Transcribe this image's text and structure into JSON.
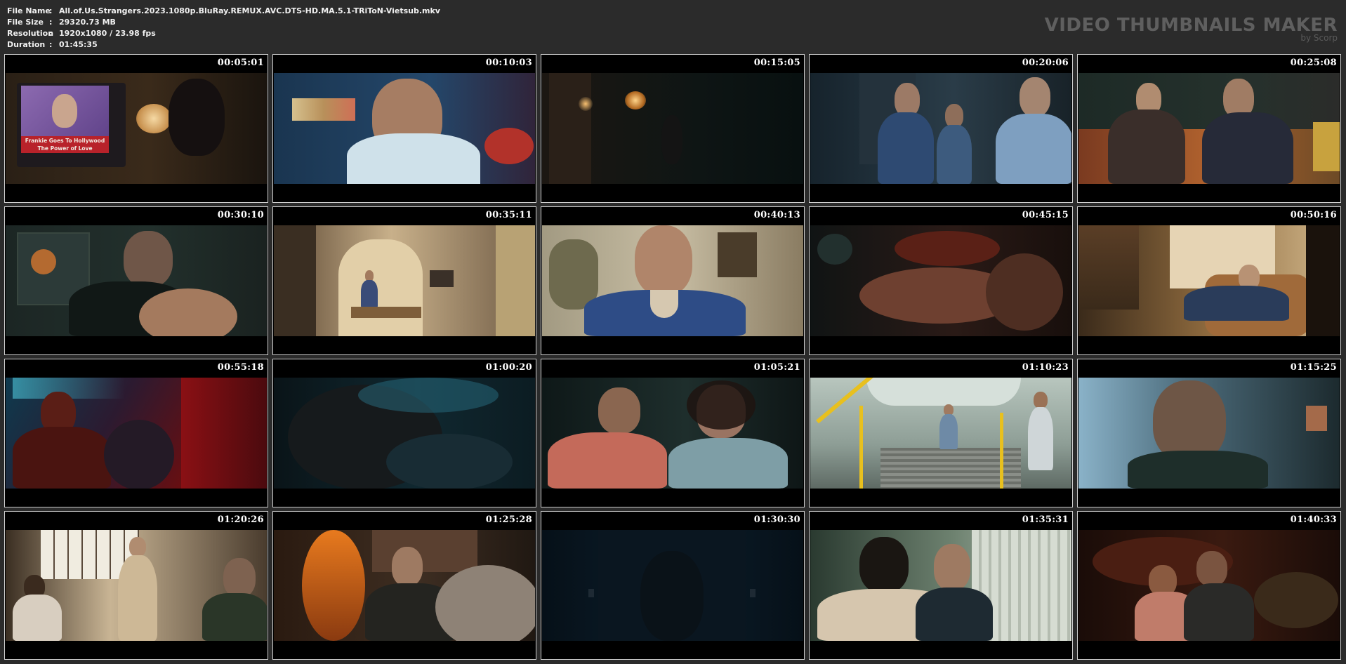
{
  "info": {
    "file_name_label": "File Name",
    "file_name": "All.of.Us.Strangers.2023.1080p.BluRay.REMUX.AVC.DTS-HD.MA.5.1-TRiToN-Vietsub.mkv",
    "file_size_label": "File Size",
    "file_size": "29320.73 MB",
    "resolution_label": "Resolution",
    "resolution": "1920x1080 / 23.98 fps",
    "duration_label": "Duration",
    "duration": "01:45:35",
    "separator": ":"
  },
  "brand": {
    "title": "VIDEO THUMBNAILS MAKER",
    "subtitle": "by Scorp"
  },
  "thumbnails": [
    {
      "time": "00:05:01"
    },
    {
      "time": "00:10:03"
    },
    {
      "time": "00:15:05"
    },
    {
      "time": "00:20:06"
    },
    {
      "time": "00:25:08"
    },
    {
      "time": "00:30:10"
    },
    {
      "time": "00:35:11"
    },
    {
      "time": "00:40:13"
    },
    {
      "time": "00:45:15"
    },
    {
      "time": "00:50:16"
    },
    {
      "time": "00:55:18"
    },
    {
      "time": "01:00:20"
    },
    {
      "time": "01:05:21"
    },
    {
      "time": "01:10:23"
    },
    {
      "time": "01:15:25"
    },
    {
      "time": "01:20:26"
    },
    {
      "time": "01:25:28"
    },
    {
      "time": "01:30:30"
    },
    {
      "time": "01:35:31"
    },
    {
      "time": "01:40:33"
    }
  ],
  "tv_caption": {
    "line1": "Frankie Goes To Hollywood",
    "line2": "The Power of Love"
  }
}
